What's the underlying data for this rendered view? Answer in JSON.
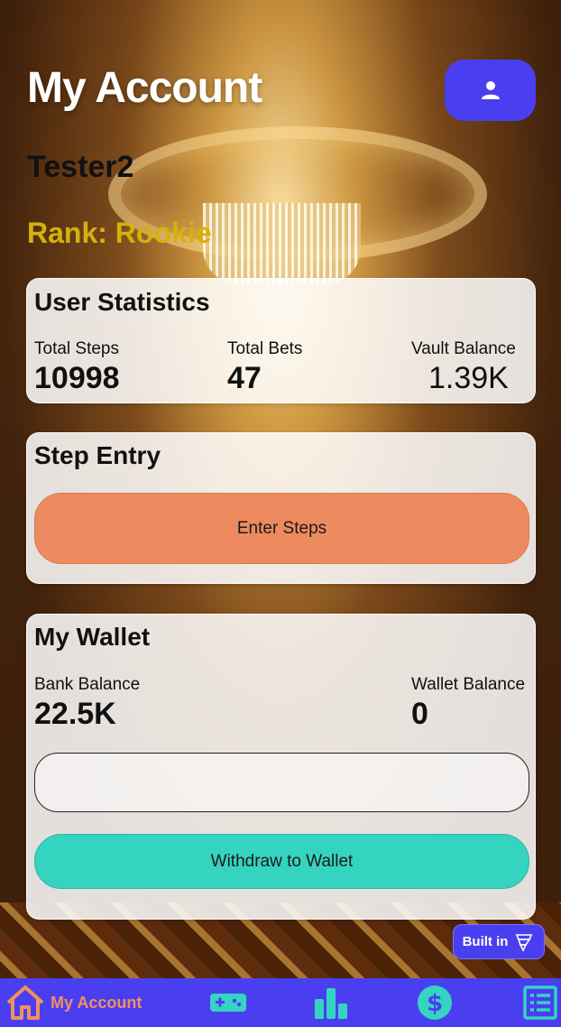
{
  "header": {
    "title": "My Account"
  },
  "user": {
    "name": "Tester2",
    "rank": "Rank: Rookie"
  },
  "stats": {
    "title": "User Statistics",
    "total_steps_label": "Total Steps",
    "total_steps_value": "10998",
    "total_bets_label": "Total Bets",
    "total_bets_value": "47",
    "vault_balance_label": "Vault Balance",
    "vault_balance_value": "1.39K"
  },
  "step_entry": {
    "title": "Step Entry",
    "button_label": "Enter Steps"
  },
  "wallet": {
    "title": "My Wallet",
    "bank_balance_label": "Bank Balance",
    "bank_balance_value": "22.5K",
    "wallet_balance_label": "Wallet Balance",
    "wallet_balance_value": "0",
    "amount_input_value": "",
    "withdraw_label": "Withdraw to Wallet"
  },
  "badge": {
    "label": "Built in"
  },
  "tabbar": {
    "items": [
      {
        "label": "My Account",
        "icon": "home-icon",
        "active": true
      },
      {
        "label": "",
        "icon": "gamepad-icon",
        "active": false
      },
      {
        "label": "",
        "icon": "bar-chart-icon",
        "active": false
      },
      {
        "label": "",
        "icon": "dollar-icon",
        "active": false
      },
      {
        "label": "",
        "icon": "list-icon",
        "active": false
      }
    ]
  },
  "colors": {
    "accent": "#4a3ff0",
    "rank": "#d4b20c",
    "steps_button": "#ee8a5f",
    "withdraw_button": "#35d4c0",
    "tab_icon": "#35d4c0",
    "tab_active": "#f29062"
  }
}
